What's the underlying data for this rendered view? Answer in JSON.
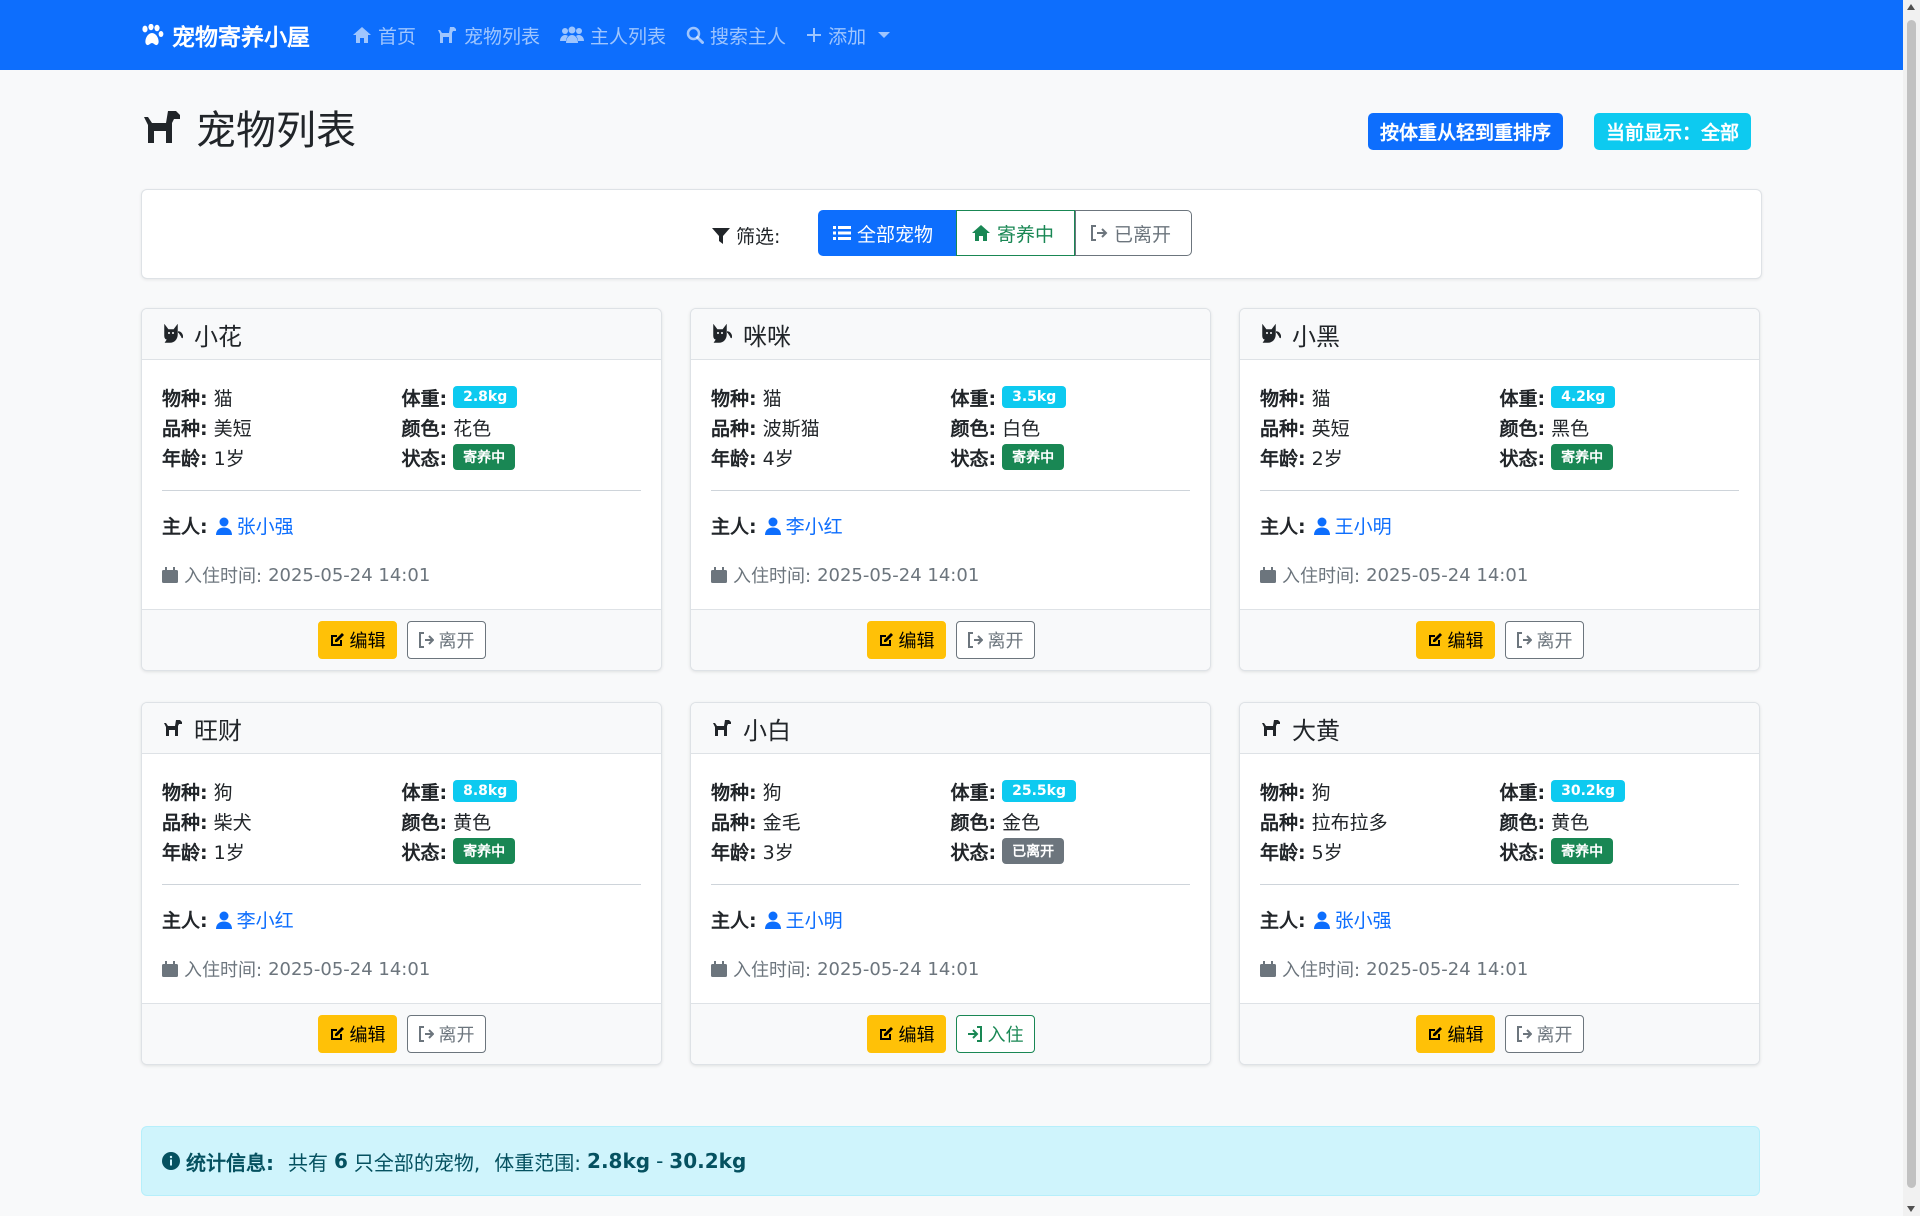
{
  "nav": {
    "brand": "宠物寄养小屋",
    "items": [
      {
        "label": "首页",
        "icon": "home-icon"
      },
      {
        "label": "宠物列表",
        "icon": "dog-icon"
      },
      {
        "label": "主人列表",
        "icon": "users-icon"
      },
      {
        "label": "搜索主人",
        "icon": "search-icon"
      },
      {
        "label": "添加",
        "icon": "plus-icon"
      }
    ]
  },
  "header": {
    "title": "宠物列表",
    "sort_button": "按体重从轻到重排序",
    "current_display": "当前显示：全部"
  },
  "filter": {
    "label": "筛选:",
    "options": [
      "全部宠物",
      "寄养中",
      "已离开"
    ],
    "active": "全部宠物"
  },
  "labels": {
    "species": "物种:",
    "weight": "体重:",
    "breed": "品种:",
    "color": "颜色:",
    "age": "年龄:",
    "status": "状态:",
    "owner": "主人:",
    "checkin": "入住时间:",
    "edit": "编辑",
    "leave": "离开",
    "checkin_btn": "入住"
  },
  "pets": [
    {
      "name": "小花",
      "type": "cat",
      "species": "猫",
      "weight": "2.8kg",
      "breed": "美短",
      "color": "花色",
      "age": "1岁",
      "status": "寄养中",
      "owner": "张小强",
      "checkin_time": "2025-05-24 14:01"
    },
    {
      "name": "咪咪",
      "type": "cat",
      "species": "猫",
      "weight": "3.5kg",
      "breed": "波斯猫",
      "color": "白色",
      "age": "4岁",
      "status": "寄养中",
      "owner": "李小红",
      "checkin_time": "2025-05-24 14:01"
    },
    {
      "name": "小黑",
      "type": "cat",
      "species": "猫",
      "weight": "4.2kg",
      "breed": "英短",
      "color": "黑色",
      "age": "2岁",
      "status": "寄养中",
      "owner": "王小明",
      "checkin_time": "2025-05-24 14:01"
    },
    {
      "name": "旺财",
      "type": "dog",
      "species": "狗",
      "weight": "8.8kg",
      "breed": "柴犬",
      "color": "黄色",
      "age": "1岁",
      "status": "寄养中",
      "owner": "李小红",
      "checkin_time": "2025-05-24 14:01"
    },
    {
      "name": "小白",
      "type": "dog",
      "species": "狗",
      "weight": "25.5kg",
      "breed": "金毛",
      "color": "金色",
      "age": "3岁",
      "status": "已离开",
      "owner": "王小明",
      "checkin_time": "2025-05-24 14:01"
    },
    {
      "name": "大黄",
      "type": "dog",
      "species": "狗",
      "weight": "30.2kg",
      "breed": "拉布拉多",
      "color": "黄色",
      "age": "5岁",
      "status": "寄养中",
      "owner": "张小强",
      "checkin_time": "2025-05-24 14:01"
    }
  ],
  "stats": {
    "label": "统计信息:",
    "prefix": "共有",
    "count": "6",
    "suffix": "只全部的宠物,",
    "range_label": "体重范围:",
    "min": "2.8kg",
    "sep": "-",
    "max": "30.2kg"
  },
  "colors": {
    "primary": "#0d6efd",
    "info": "#0dcaf0",
    "success": "#198754",
    "secondary": "#6c757d",
    "warning": "#ffc107"
  }
}
